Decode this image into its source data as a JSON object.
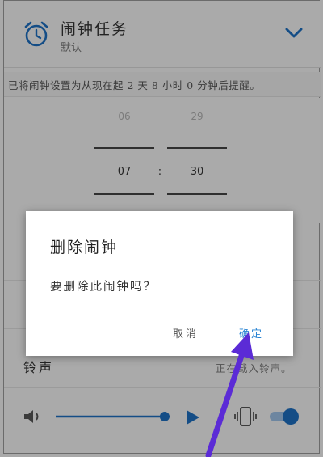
{
  "header": {
    "title": "闹钟任务",
    "subtitle": "默认"
  },
  "info": {
    "message": "已将闹钟设置为从现在起 2 天 8 小时 0 分钟后提醒。"
  },
  "time_picker": {
    "hour_prev": "06",
    "minute_prev": "29",
    "hour": "07",
    "separator": ":",
    "minute": "30"
  },
  "ringtone": {
    "label": "铃声",
    "value": "正在载入铃声。"
  },
  "dialog": {
    "title": "删除闹钟",
    "message": "要删除此闹钟吗？",
    "cancel_label": "取消",
    "ok_label": "确定"
  },
  "controls": {
    "volume_level": 0.95,
    "vibrate_on": true
  },
  "colors": {
    "accent": "#1e6fc0",
    "dialog_button": "#2a84d3",
    "arrow": "#5b2bd6"
  },
  "icons": [
    "alarm-clock-icon",
    "chevron-down-icon",
    "volume-icon",
    "play-icon",
    "vibrate-icon"
  ]
}
